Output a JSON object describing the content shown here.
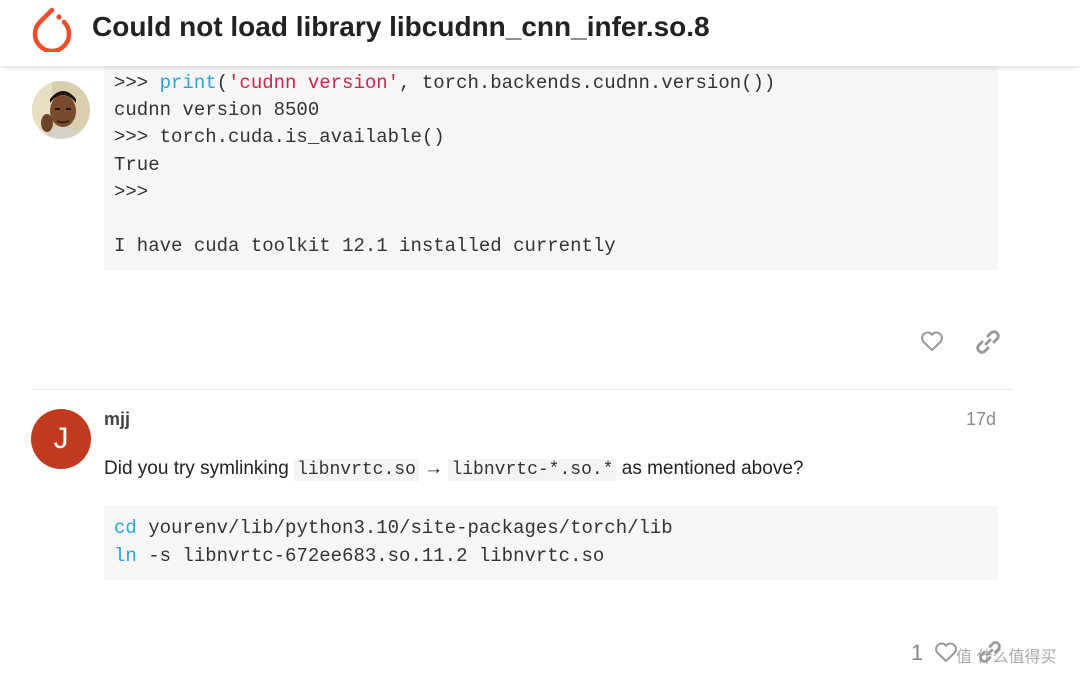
{
  "header": {
    "title": "Could not load library libcudnn_cnn_infer.so.8",
    "logo_icon": "pytorch-logo",
    "accent_color": "#ee4c2c"
  },
  "post1": {
    "avatar_icon": "user-photo-avatar",
    "code_lines": [
      {
        "prompt": ">>> ",
        "func": "print",
        "open": "(",
        "str": "'cudnn version'",
        "rest": ", torch.backends.cudnn.version())"
      },
      {
        "text": "cudnn version 8500"
      },
      {
        "text": ">>> torch.cuda.is_available()"
      },
      {
        "text": "True"
      },
      {
        "text": ">>>"
      },
      {
        "text": ""
      },
      {
        "text": "I have cuda toolkit 12.1 installed currently"
      }
    ],
    "like_icon": "heart-icon",
    "share_icon": "link-icon"
  },
  "post2": {
    "avatar_letter": "J",
    "avatar_color": "#c1391f",
    "username": "mjj",
    "date": "17d",
    "text_before": "Did you try symlinking ",
    "code_a": "libnvrtc.so",
    "arrow": " → ",
    "code_b": "libnvrtc-*.so.*",
    "text_after": " as mentioned above?",
    "code_lines": [
      {
        "cmd": "cd",
        "args": " yourenv/lib/python3.10/site-packages/torch/lib"
      },
      {
        "cmd": "ln",
        "args": " -s libnvrtc-672ee683.so.11.2 libnvrtc.so"
      }
    ],
    "like_count": "1"
  },
  "watermark": "值 什么值得买"
}
